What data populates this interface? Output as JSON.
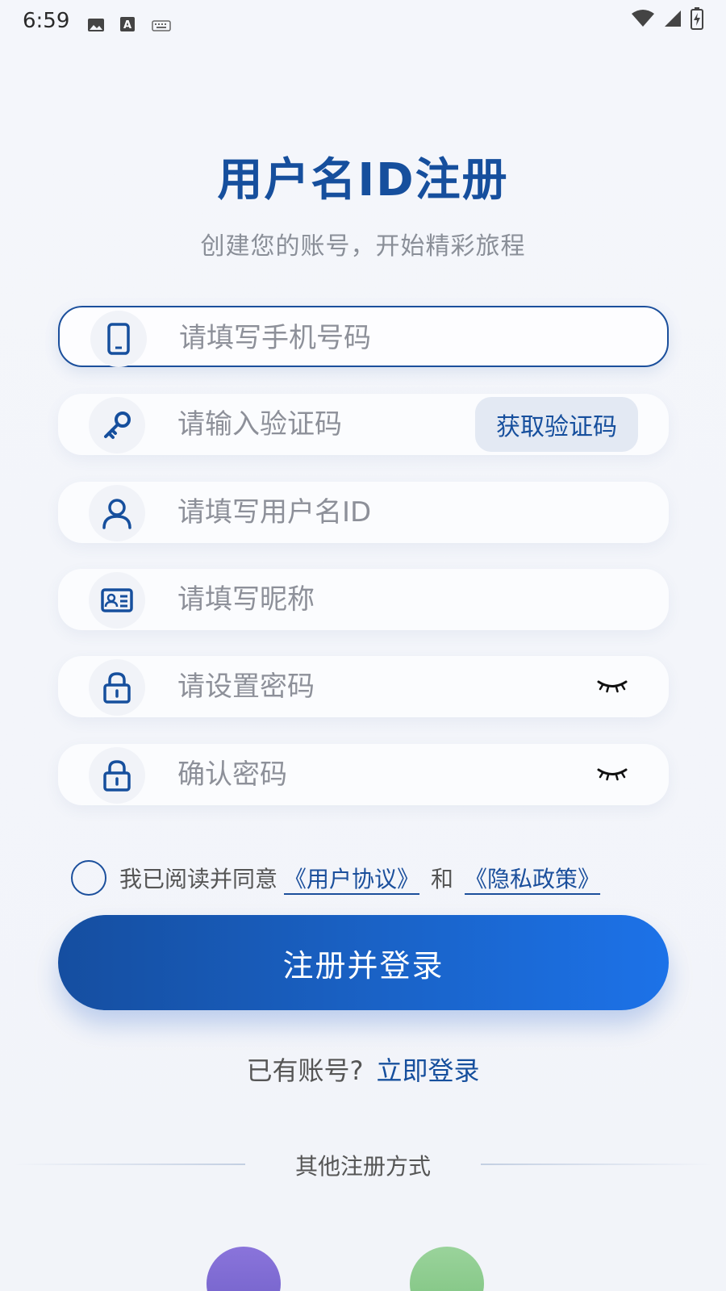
{
  "status_bar": {
    "time": "6:59",
    "icons": [
      "image-icon",
      "font-icon",
      "keyboard-icon",
      "wifi-icon",
      "signal-icon",
      "battery-icon"
    ]
  },
  "header": {
    "title": "用户名ID注册",
    "subtitle": "创建您的账号，开始精彩旅程"
  },
  "form": {
    "phone": {
      "placeholder": "请填写手机号码",
      "icon": "phone-icon"
    },
    "code": {
      "placeholder": "请输入验证码",
      "icon": "key-icon",
      "button_label": "获取验证码"
    },
    "username": {
      "placeholder": "请填写用户名ID",
      "icon": "user-icon"
    },
    "nickname": {
      "placeholder": "请填写昵称",
      "icon": "id-card-icon"
    },
    "password": {
      "placeholder": "请设置密码",
      "icon": "lock-icon"
    },
    "confirm_password": {
      "placeholder": "确认密码",
      "icon": "lock-icon"
    }
  },
  "agreement": {
    "prefix": "我已阅读并同意",
    "user_agreement": "《用户协议》",
    "and": "和",
    "privacy_policy": "《隐私政策》"
  },
  "submit_label": "注册并登录",
  "login_prompt": {
    "text": "已有账号?",
    "link": "立即登录"
  },
  "other_methods_label": "其他注册方式",
  "colors": {
    "brand": "#164f9d",
    "button_start": "#154ea0",
    "button_end": "#1c72e8"
  }
}
